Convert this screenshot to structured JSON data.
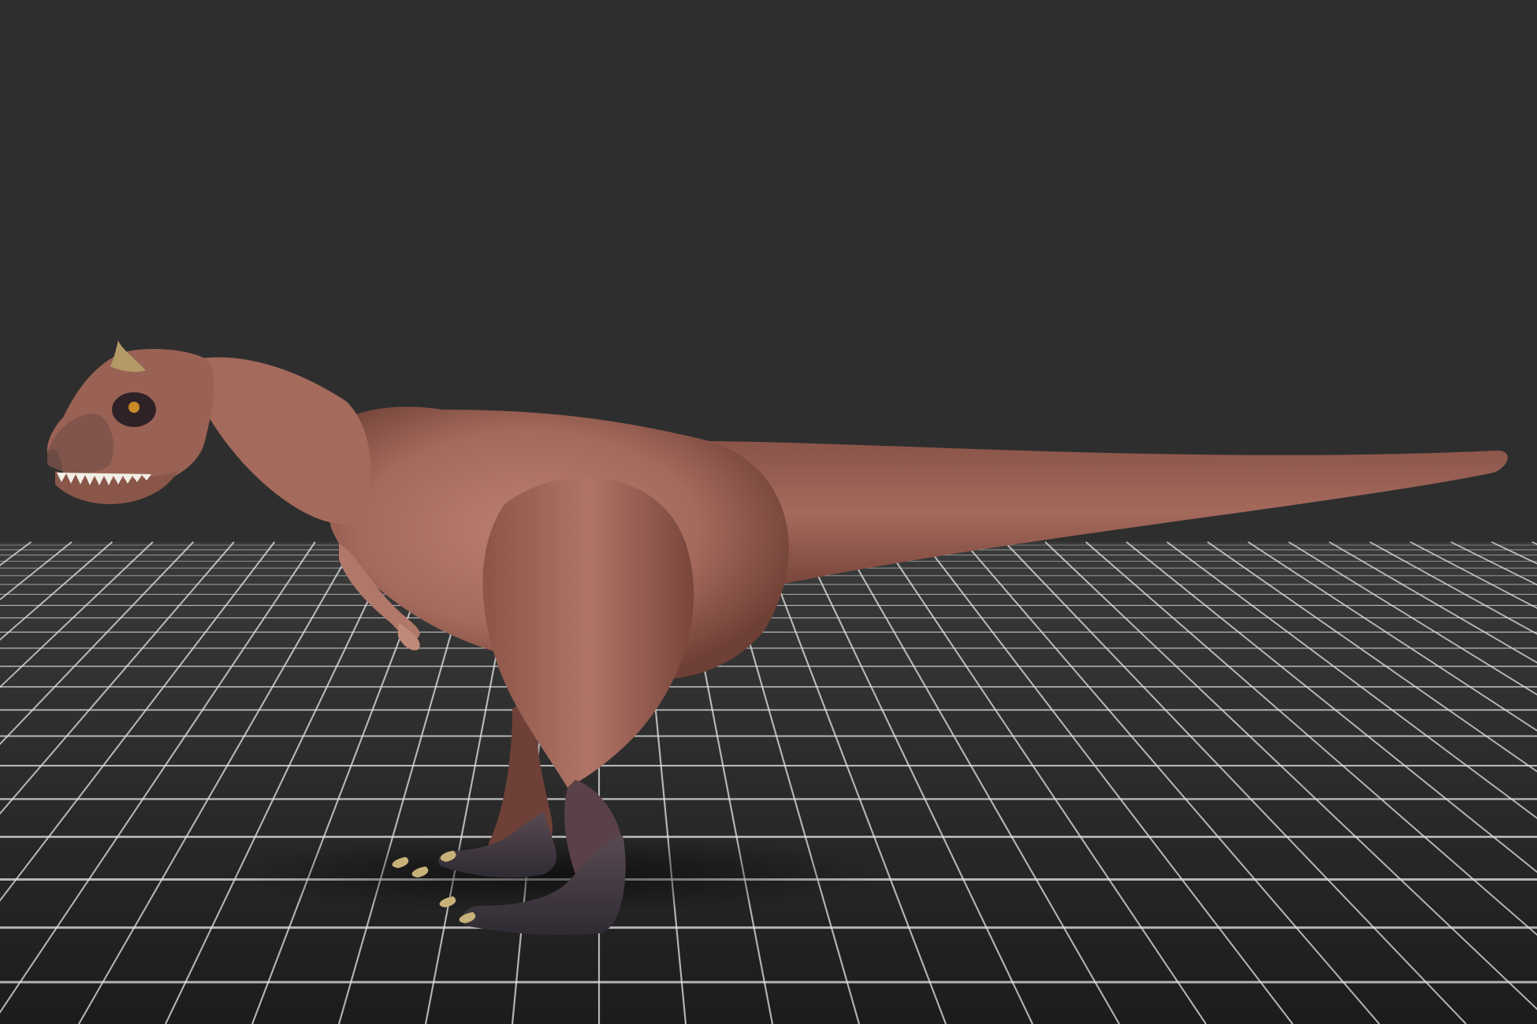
{
  "viewport": {
    "background_color": "#2e2e2e",
    "horizon_color": "#3a3a3a"
  },
  "ground_grid": {
    "visible": true,
    "line_color": "#e6e6e6",
    "floor_color": "#262626"
  },
  "model": {
    "subject": "carnotaurus-dinosaur",
    "view": "side-profile-facing-left",
    "skin_color": "#a46a5c",
    "skin_shadow_color": "#6e3f35",
    "belly_color": "#c08a78",
    "foot_color": "#3e3a44",
    "claw_color": "#c9b27a",
    "horn_color": "#b39a66",
    "teeth_color": "#f2efe6"
  }
}
